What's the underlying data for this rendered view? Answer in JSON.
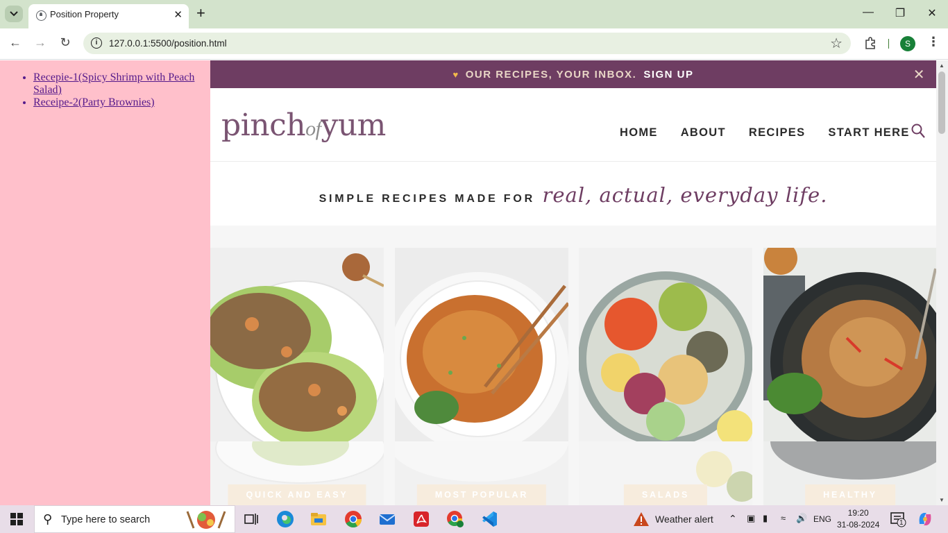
{
  "browser": {
    "tab_title": "Position Property",
    "url": "127.0.0.1:5500/position.html",
    "profile_initial": "S",
    "new_tab_symbol": "+",
    "tab_close_symbol": "✕"
  },
  "sidebar": {
    "links": [
      {
        "label": "Recepie-1(Spicy Shrimp with Peach Salad)"
      },
      {
        "label": "Receipe-2(Party Brownies)"
      }
    ]
  },
  "site": {
    "promo": {
      "text": "OUR RECIPES, YOUR INBOX.",
      "cta": "SIGN UP"
    },
    "logo": {
      "part1": "pinch",
      "part2": "of",
      "part3": "yum"
    },
    "nav": [
      {
        "label": "HOME"
      },
      {
        "label": "ABOUT"
      },
      {
        "label": "RECIPES"
      },
      {
        "label": "START HERE"
      }
    ],
    "tagline": {
      "caps": "SIMPLE RECIPES MADE FOR",
      "script": "real, actual, everyday life."
    },
    "categories": [
      {
        "label": "QUICK AND EASY"
      },
      {
        "label": "MOST POPULAR"
      },
      {
        "label": "SALADS"
      },
      {
        "label": "HEALTHY"
      }
    ],
    "colors": {
      "plum": "#6e3d62",
      "promo_text": "#e9d6c6",
      "sidebar_bg": "#ffc0cb"
    }
  },
  "taskbar": {
    "search_placeholder": "Type here to search",
    "weather": "Weather alert",
    "language": "ENG",
    "time": "19:20",
    "date": "31-08-2024",
    "notification_count": "1"
  }
}
